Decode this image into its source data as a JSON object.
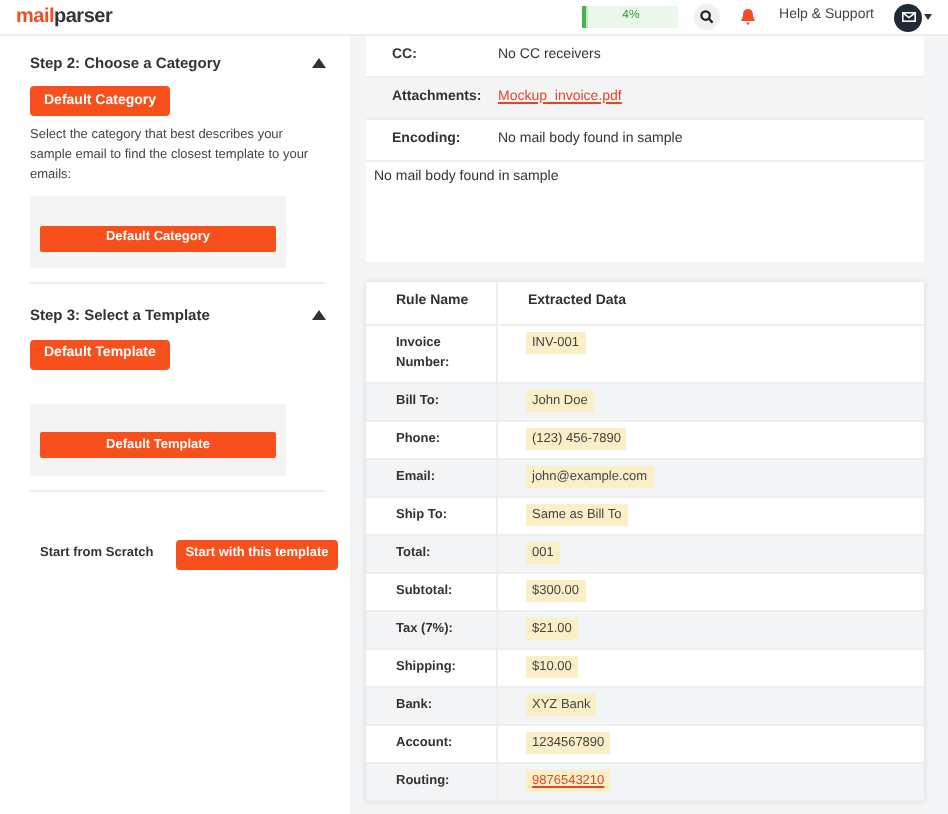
{
  "header": {
    "logo": {
      "accent": "mail",
      "rest": "parser"
    },
    "progress": {
      "label": "4%",
      "level": 0.04
    },
    "help": "Help & Support"
  },
  "steps": [
    {
      "title": "Step 2: Choose a Category",
      "expanded": true,
      "button": "Default Category",
      "description": "Select the category that best describes your sample email to find the closest template to your emails:",
      "option": "Default Category"
    },
    {
      "title": "Step 3: Select a Template",
      "expanded": true,
      "button": "Default Template",
      "option": "Default Template"
    }
  ],
  "actions": {
    "secondary": "Start from Scratch",
    "primary": "Start with this template"
  },
  "email_fields": [
    {
      "label": "CC:",
      "value": "No CC receivers",
      "kind": "text"
    },
    {
      "label": "Attachments:",
      "value": "Mockup_invoice.pdf",
      "kind": "link"
    },
    {
      "label": "Encoding:",
      "value": "No mail body found in sample",
      "kind": "text"
    }
  ],
  "body_text": "No mail body found in sample",
  "table": {
    "columns": [
      "Rule Name",
      "Extracted Data"
    ],
    "rows": [
      {
        "name": "Invoice Number:",
        "value": "INV-001",
        "kind": "text"
      },
      {
        "name": "Bill To:",
        "value": "John Doe",
        "kind": "text"
      },
      {
        "name": "Phone:",
        "value": "(123) 456-7890",
        "kind": "text"
      },
      {
        "name": "Email:",
        "value": "john@example.com",
        "kind": "text"
      },
      {
        "name": "Ship To:",
        "value": "Same as Bill To",
        "kind": "text"
      },
      {
        "name": "Total:",
        "value": "001",
        "kind": "text"
      },
      {
        "name": "Subtotal:",
        "value": "$300.00",
        "kind": "text"
      },
      {
        "name": "Tax (7%):",
        "value": "$21.00",
        "kind": "text"
      },
      {
        "name": "Shipping:",
        "value": "$10.00",
        "kind": "text"
      },
      {
        "name": "Bank:",
        "value": "XYZ Bank",
        "kind": "text"
      },
      {
        "name": "Account:",
        "value": "1234567890",
        "kind": "text"
      },
      {
        "name": "Routing:",
        "value": "9876543210",
        "kind": "link"
      }
    ]
  }
}
